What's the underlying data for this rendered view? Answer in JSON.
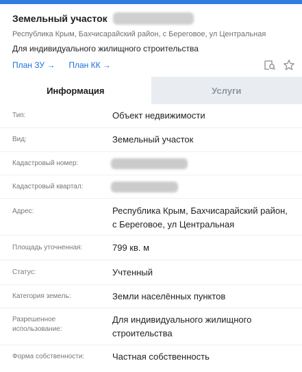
{
  "header": {
    "title": "Земельный участок",
    "address": "Республика Крым, Бахчисарайский район, с Береговое, ул Центральная",
    "purpose": "Для индивидуального жилищного строительства",
    "link_plan_zu": "План ЗУ →",
    "link_plan_kk": "План КК →"
  },
  "tabs": {
    "info": "Информация",
    "services": "Услуги"
  },
  "fields": {
    "type_label": "Тип:",
    "type_value": "Объект недвижимости",
    "kind_label": "Вид:",
    "kind_value": "Земельный участок",
    "cadastral_number_label": "Кадастровый номер:",
    "cadastral_block_label": "Кадастровый квартал:",
    "address_label": "Адрес:",
    "address_value": "Республика Крым, Бахчисарайский район, с Береговое, ул Центральная",
    "area_label": "Площадь уточненная:",
    "area_value": "799 кв. м",
    "status_label": "Статус:",
    "status_value": "Учтенный",
    "category_label": "Категория земель:",
    "category_value": "Земли населённых пунктов",
    "permitted_use_label": "Разрешенное использование:",
    "permitted_use_value": "Для индивидуального жилищного строительства",
    "ownership_label": "Форма собственности:",
    "ownership_value": "Частная собственность"
  },
  "colors": {
    "accent": "#1a6fd8",
    "topbar": "#2f7de1",
    "inactive_tab": "#e9edf2"
  },
  "icons": {
    "map_search": "map-search-icon",
    "favorite": "star-icon"
  }
}
